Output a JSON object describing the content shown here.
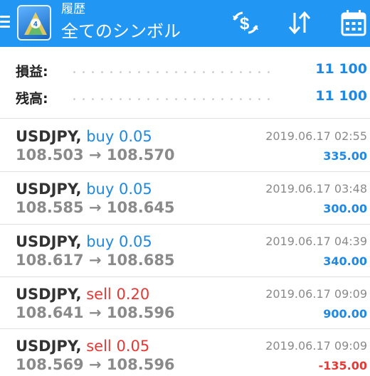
{
  "header": {
    "subtitle": "履歴",
    "title": "全てのシンボル",
    "icons": [
      "menu-icon",
      "metatrader-logo-icon",
      "currency-exchange-icon",
      "sort-icon",
      "calendar-icon"
    ]
  },
  "summary": {
    "profit_label": "損益:",
    "profit_value": "11 100",
    "balance_label": "残高:",
    "balance_value": "11 100"
  },
  "deals": [
    {
      "symbol": "USDJPY,",
      "side": "buy",
      "volume": "0.05",
      "open_price": "108.503",
      "arrow": "→",
      "close_price": "108.570",
      "time": "2019.06.17 02:55",
      "profit": "335.00"
    },
    {
      "symbol": "USDJPY,",
      "side": "buy",
      "volume": "0.05",
      "open_price": "108.585",
      "arrow": "→",
      "close_price": "108.645",
      "time": "2019.06.17 03:48",
      "profit": "300.00"
    },
    {
      "symbol": "USDJPY,",
      "side": "buy",
      "volume": "0.05",
      "open_price": "108.617",
      "arrow": "→",
      "close_price": "108.685",
      "time": "2019.06.17 04:39",
      "profit": "340.00"
    },
    {
      "symbol": "USDJPY,",
      "side": "sell",
      "volume": "0.20",
      "open_price": "108.641",
      "arrow": "→",
      "close_price": "108.596",
      "time": "2019.06.17 09:09",
      "profit": "900.00"
    },
    {
      "symbol": "USDJPY,",
      "side": "sell",
      "volume": "0.05",
      "open_price": "108.569",
      "arrow": "→",
      "close_price": "108.596",
      "time": "2019.06.17 09:09",
      "profit": "-135.00"
    }
  ],
  "colors": {
    "header_bg": "#2196f3",
    "buy": "#1e88e5",
    "sell": "#e53935",
    "muted": "#8a8a8a"
  }
}
